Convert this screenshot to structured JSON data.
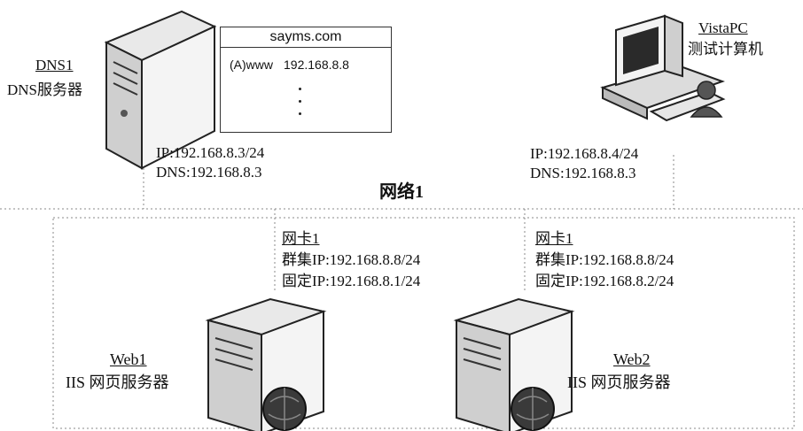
{
  "dns_server": {
    "name": "DNS1",
    "role": "DNS服务器",
    "ip": "IP:192.168.8.3/24",
    "dns": "DNS:192.168.8.3"
  },
  "dns_zone": {
    "zone": "sayms.com",
    "record_type": "(A)www",
    "record_ip": "192.168.8.8"
  },
  "client": {
    "name": "VistaPC",
    "role": "测试计算机",
    "ip": "IP:192.168.8.4/24",
    "dns": "DNS:192.168.8.3"
  },
  "network_label": "网络1",
  "web1": {
    "nic": "网卡1",
    "cluster_ip": "群集IP:192.168.8.8/24",
    "fixed_ip": "固定IP:192.168.8.1/24",
    "name": "Web1",
    "role": "IIS 网页服务器"
  },
  "web2": {
    "nic": "网卡1",
    "cluster_ip": "群集IP:192.168.8.8/24",
    "fixed_ip": "固定IP:192.168.8.2/24",
    "name": "Web2",
    "role": "IIS 网页服务器"
  }
}
